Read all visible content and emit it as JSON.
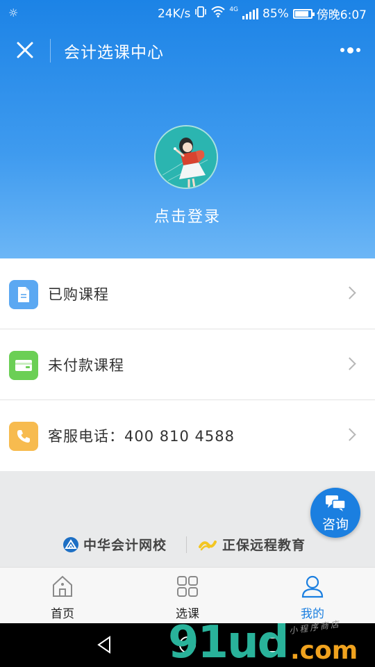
{
  "status_bar": {
    "network_speed": "24K/s",
    "network_type": "4G",
    "battery_percent": "85%",
    "battery_level": 0.85,
    "time": "傍晚6:07"
  },
  "navbar": {
    "title": "会计选课中心"
  },
  "profile": {
    "login_text": "点击登录"
  },
  "menu": {
    "items": [
      {
        "label": "已购课程",
        "icon": "document-icon",
        "icon_color": "#5ba8f2"
      },
      {
        "label": "未付款课程",
        "icon": "wallet-icon",
        "icon_color": "#6bcf55"
      },
      {
        "label": "客服电话：400 810 4588",
        "icon": "phone-icon",
        "icon_color": "#f7bb4f"
      }
    ]
  },
  "consult": {
    "label": "咨询"
  },
  "brands": {
    "brand1": "中华会计网校",
    "brand2": "正保远程教育"
  },
  "tabbar": {
    "tabs": [
      {
        "label": "首页",
        "icon": "home-icon"
      },
      {
        "label": "选课",
        "icon": "grid-icon"
      },
      {
        "label": "我的",
        "icon": "user-icon",
        "active": true
      }
    ]
  },
  "watermark": {
    "digits": "91ud",
    "domain": ".com",
    "tagline": "小程序商店"
  },
  "colors": {
    "accent": "#1b7fe0",
    "header_top": "#1c83e6",
    "header_bottom": "#6cb6f6"
  }
}
